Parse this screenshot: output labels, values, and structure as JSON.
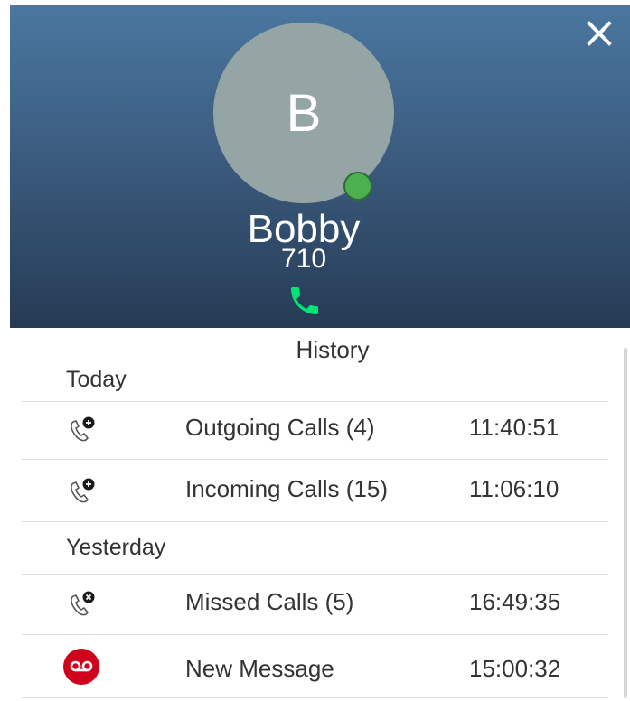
{
  "contact": {
    "avatar_initial": "B",
    "name": "Bobby",
    "extension": "710",
    "presence": "available",
    "presence_color": "#4caf50"
  },
  "header": {
    "close_icon": "close-icon",
    "call_icon": "phone-icon",
    "call_color": "#00e676",
    "gradient_top": "#4a77a0",
    "gradient_bottom": "#263b55"
  },
  "history": {
    "title": "History",
    "groups": [
      {
        "label": "Today",
        "items": [
          {
            "icon": "outgoing-call-icon",
            "label": "Outgoing Calls (4)",
            "time": "11:40:51"
          },
          {
            "icon": "incoming-call-icon",
            "label": "Incoming Calls (15)",
            "time": "11:06:10"
          }
        ]
      },
      {
        "label": "Yesterday",
        "items": [
          {
            "icon": "missed-call-icon",
            "label": "Missed Calls (5)",
            "time": "16:49:35"
          },
          {
            "icon": "voicemail-icon",
            "label": "New Message",
            "time": "15:00:32",
            "icon_color": "#d0021b"
          }
        ]
      }
    ]
  }
}
